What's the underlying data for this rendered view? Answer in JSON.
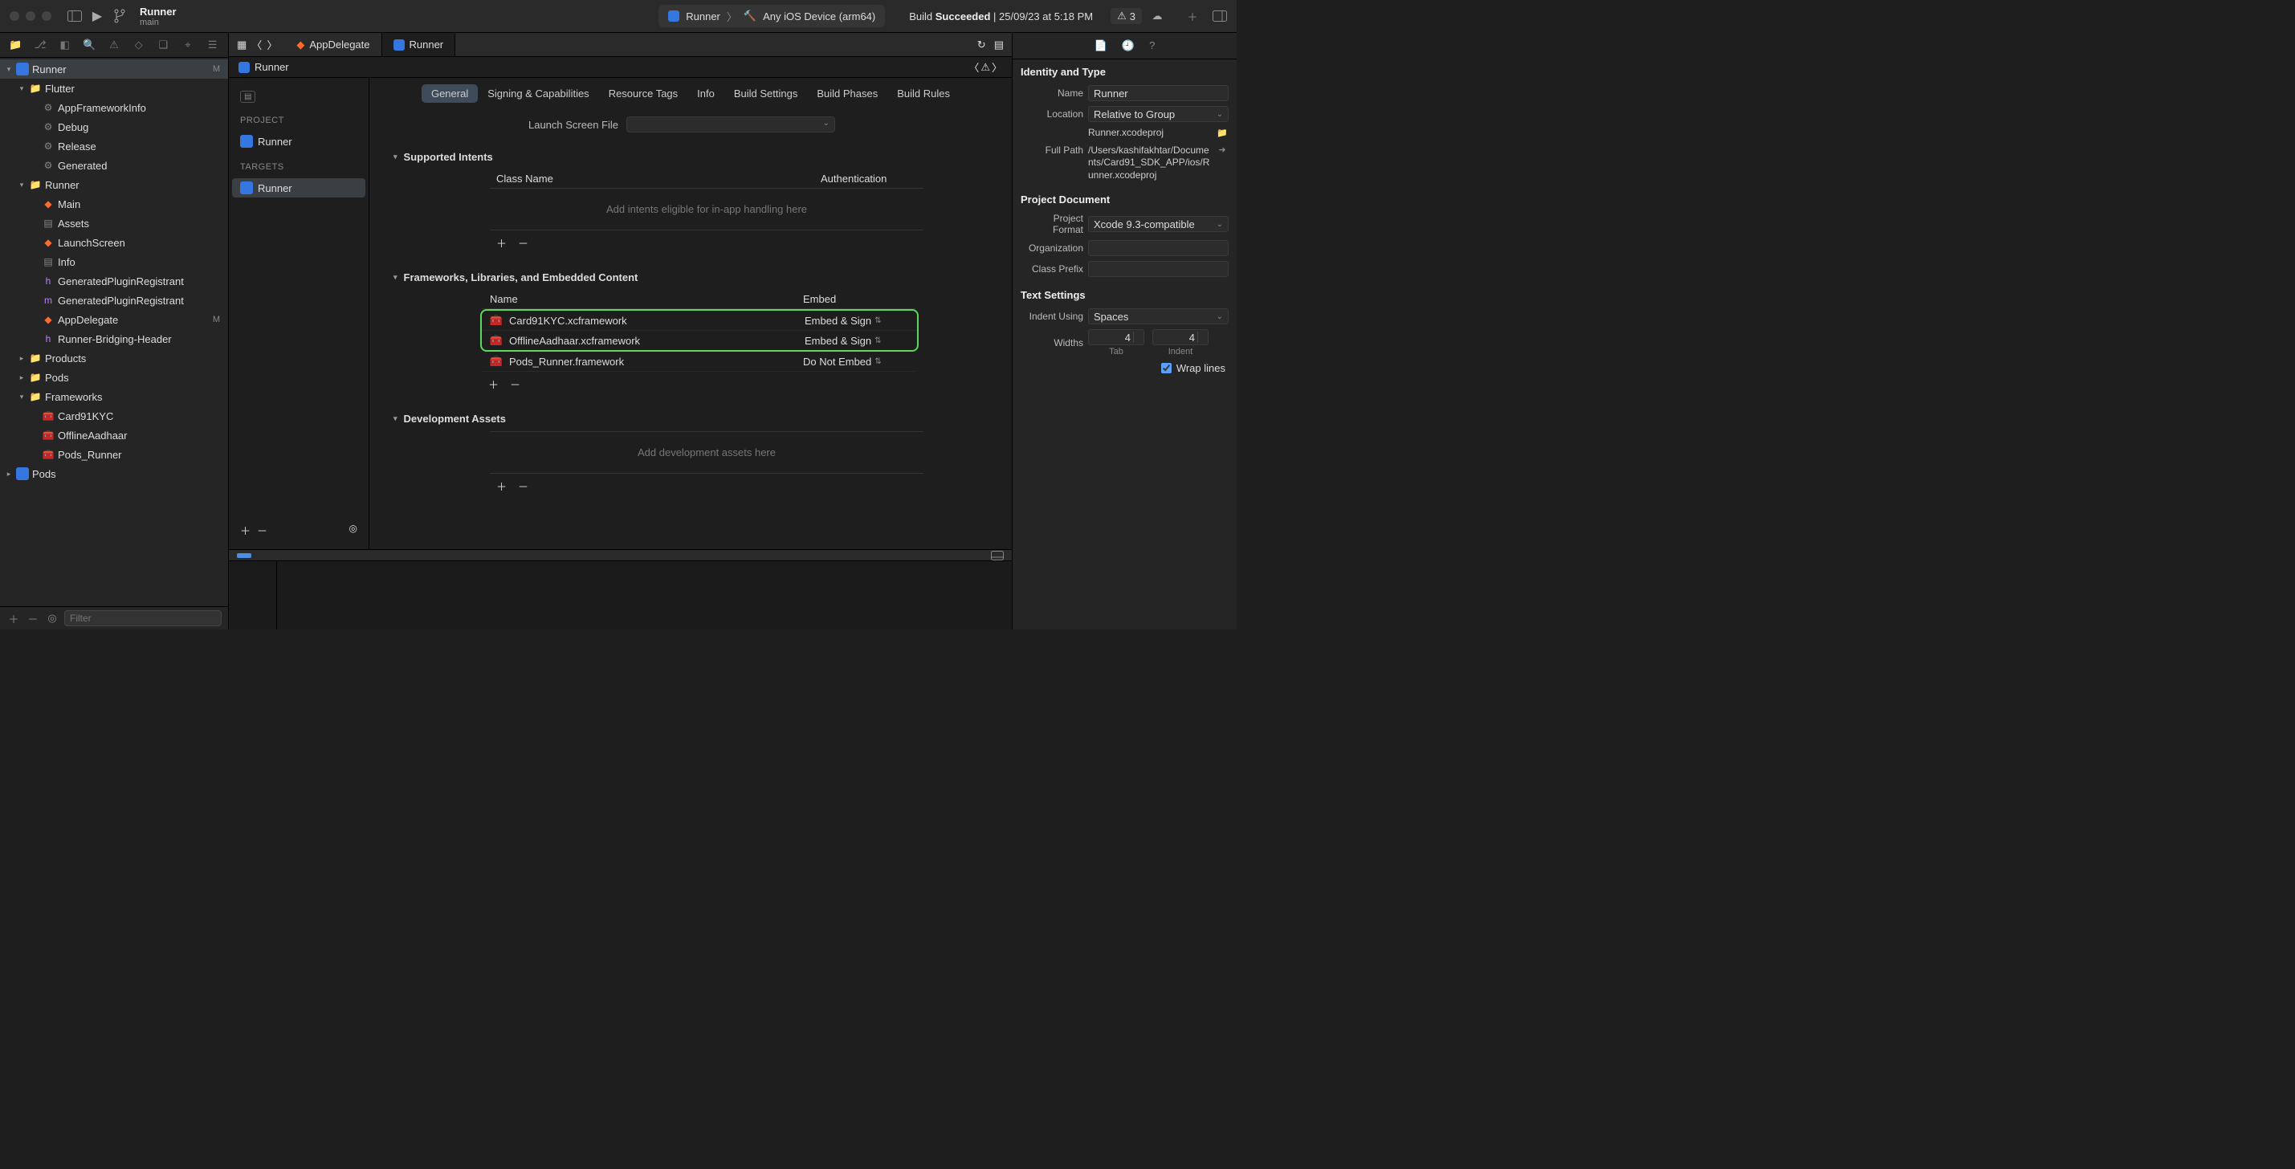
{
  "toolbar": {
    "project_name": "Runner",
    "branch": "main",
    "scheme_app": "Runner",
    "scheme_device": "Any iOS Device (arm64)",
    "build_status_prefix": "Build ",
    "build_status_word": "Succeeded",
    "build_status_suffix": " | 25/09/23 at 5:18 PM",
    "issue_count": "3"
  },
  "navigator": {
    "items": [
      {
        "d": 0,
        "k": "proj",
        "label": "Runner",
        "tag": "M",
        "disc": "▾",
        "sel": true
      },
      {
        "d": 1,
        "k": "folder",
        "label": "Flutter",
        "disc": "▾"
      },
      {
        "d": 2,
        "k": "gear",
        "label": "AppFrameworkInfo"
      },
      {
        "d": 2,
        "k": "gear",
        "label": "Debug"
      },
      {
        "d": 2,
        "k": "gear",
        "label": "Release"
      },
      {
        "d": 2,
        "k": "gear",
        "label": "Generated"
      },
      {
        "d": 1,
        "k": "folder",
        "label": "Runner",
        "disc": "▾"
      },
      {
        "d": 2,
        "k": "swift",
        "label": "Main"
      },
      {
        "d": 2,
        "k": "plist",
        "label": "Assets"
      },
      {
        "d": 2,
        "k": "swift",
        "label": "LaunchScreen"
      },
      {
        "d": 2,
        "k": "plist",
        "label": "Info"
      },
      {
        "d": 2,
        "k": "h",
        "label": "GeneratedPluginRegistrant"
      },
      {
        "d": 2,
        "k": "m",
        "label": "GeneratedPluginRegistrant"
      },
      {
        "d": 2,
        "k": "swift",
        "label": "AppDelegate",
        "tag": "M"
      },
      {
        "d": 2,
        "k": "h",
        "label": "Runner-Bridging-Header"
      },
      {
        "d": 1,
        "k": "folder",
        "label": "Products",
        "disc": "▸"
      },
      {
        "d": 1,
        "k": "folder",
        "label": "Pods",
        "disc": "▸"
      },
      {
        "d": 1,
        "k": "folder",
        "label": "Frameworks",
        "disc": "▾"
      },
      {
        "d": 2,
        "k": "fw",
        "label": "Card91KYC"
      },
      {
        "d": 2,
        "k": "fw",
        "label": "OfflineAadhaar"
      },
      {
        "d": 2,
        "k": "fw",
        "label": "Pods_Runner"
      },
      {
        "d": 0,
        "k": "proj",
        "label": "Pods",
        "disc": "▸"
      }
    ],
    "filter_placeholder": "Filter"
  },
  "tabs": {
    "t1": "AppDelegate",
    "t2": "Runner"
  },
  "crumb": "Runner",
  "outline": {
    "project_hdr": "PROJECT",
    "project_item": "Runner",
    "targets_hdr": "TARGETS",
    "target_item": "Runner"
  },
  "seg": {
    "general": "General",
    "signing": "Signing & Capabilities",
    "resource": "Resource Tags",
    "info": "Info",
    "buildset": "Build Settings",
    "phases": "Build Phases",
    "rules": "Build Rules"
  },
  "sections": {
    "launch_label": "Launch Screen File",
    "intents_title": "Supported Intents",
    "intents_col1": "Class Name",
    "intents_col2": "Authentication",
    "intents_placeholder": "Add intents eligible for in-app handling here",
    "fw_title": "Frameworks, Libraries, and Embedded Content",
    "fw_col1": "Name",
    "fw_col2": "Embed",
    "fw_rows": [
      {
        "name": "Card91KYC.xcframework",
        "embed": "Embed & Sign",
        "hl": true
      },
      {
        "name": "OfflineAadhaar.xcframework",
        "embed": "Embed & Sign",
        "hl": true
      },
      {
        "name": "Pods_Runner.framework",
        "embed": "Do Not Embed",
        "hl": false
      }
    ],
    "dev_title": "Development Assets",
    "dev_placeholder": "Add development assets here"
  },
  "inspector": {
    "identity_title": "Identity and Type",
    "name_label": "Name",
    "name_value": "Runner",
    "location_label": "Location",
    "location_value": "Relative to Group",
    "location_file": "Runner.xcodeproj",
    "fullpath_label": "Full Path",
    "fullpath_value": "/Users/kashifakhtar/Documents/Card91_SDK_APP/ios/Runner.xcodeproj",
    "projdoc_title": "Project Document",
    "format_label": "Project Format",
    "format_value": "Xcode 9.3-compatible",
    "org_label": "Organization",
    "classprefix_label": "Class Prefix",
    "text_title": "Text Settings",
    "indent_label": "Indent Using",
    "indent_value": "Spaces",
    "widths_label": "Widths",
    "tab_width": "4",
    "indent_width": "4",
    "tab_cap": "Tab",
    "indent_cap": "Indent",
    "wrap_label": "Wrap lines"
  }
}
